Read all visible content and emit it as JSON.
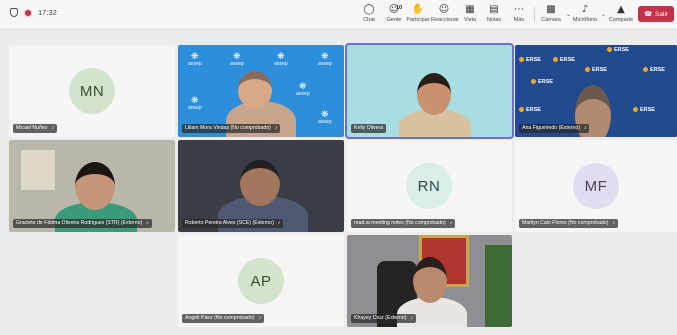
{
  "toolbar": {
    "time": "17:32",
    "chat": "Chat",
    "people": "Gente",
    "people_count": "10",
    "raise": "Participar",
    "react": "Reaccionar",
    "view": "Vista",
    "notes": "Notas",
    "more": "Más",
    "camera": "Cámara",
    "mic": "Micrófono",
    "share": "Comparte",
    "leave": "Salir"
  },
  "tiles": [
    {
      "label": "Micael Nuñez",
      "initials": "MN"
    },
    {
      "label": "Liliam Mora Vindas (No comprobado)"
    },
    {
      "label": "Kelly Olivera"
    },
    {
      "label": "Ana Figueiredo (Externo)"
    },
    {
      "label": "Graciete de Fátima Oliveira Rodrigues (STR) (Externo)"
    },
    {
      "label": "Roberto Pereira Alves (SCE) (Externo)"
    },
    {
      "label": "read.ai meeting notes (No comprobado)",
      "initials": "RN"
    },
    {
      "label": "Marilyn Calo Flores (No comprobado)",
      "initials": "MF"
    },
    {
      "label": "Angeli Páez (No comprobado)",
      "initials": "AP"
    },
    {
      "label": "Khayey Cruz (Externo)"
    }
  ],
  "brand": {
    "ansep": "ansep",
    "erse": "ERSE"
  },
  "colors": {
    "leave": "#c4314b",
    "active_speaker": "#6a6fd1",
    "ansep_bg": "#2d8fdb",
    "erse_bg": "#214a8f"
  },
  "icons": [
    "shield-icon",
    "record-icon",
    "chat-icon",
    "people-icon",
    "raise-hand-icon",
    "react-icon",
    "view-icon",
    "notes-icon",
    "more-icon",
    "camera-icon",
    "mic-icon",
    "share-icon",
    "phone-icon"
  ]
}
